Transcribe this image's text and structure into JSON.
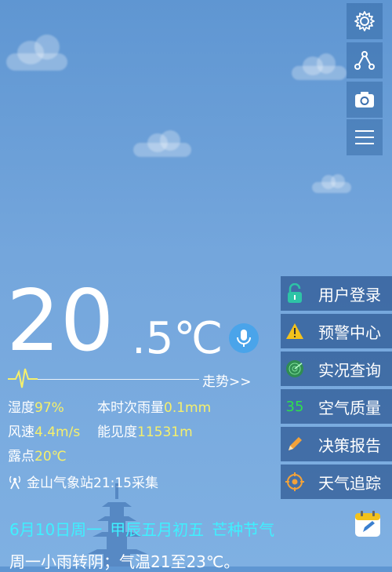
{
  "toolbar": {
    "icons": [
      "gear-icon",
      "share-icon",
      "camera-icon",
      "menu-icon"
    ]
  },
  "temperature": {
    "integer": "20",
    "decimal": ".5℃"
  },
  "trend": {
    "label": "走势>>"
  },
  "weather": {
    "humidity_label": "湿度",
    "humidity_value": "97%",
    "rain_label": "本时次雨量",
    "rain_value": "0.1mm",
    "wind_label": "风速",
    "wind_value": "4.4m/s",
    "visibility_label": "能见度",
    "visibility_value": "11531m",
    "dewpoint_label": "露点",
    "dewpoint_value": "20℃"
  },
  "station": {
    "text": "金山气象站21:15采集"
  },
  "menu": {
    "items": [
      {
        "label": "用户登录",
        "icon": "lock-icon"
      },
      {
        "label": "预警中心",
        "icon": "warning-icon"
      },
      {
        "label": "实况查询",
        "icon": "radar-icon"
      },
      {
        "label": "空气质量",
        "icon": "aqi-badge",
        "badge": "35"
      },
      {
        "label": "决策报告",
        "icon": "pencil-icon"
      },
      {
        "label": "天气追踪",
        "icon": "target-icon"
      }
    ]
  },
  "date": {
    "solar": "6月10日周一",
    "lunar": "甲辰五月初五",
    "term": "芒种节气"
  },
  "forecast": {
    "text": "周一小雨转阴；气温21至23℃。"
  },
  "colors": {
    "accent_cyan": "#3ff0ff",
    "value_yellow": "#f6f06b",
    "aqi_green": "#2ee04c",
    "mic_blue": "#4aa4ea"
  }
}
